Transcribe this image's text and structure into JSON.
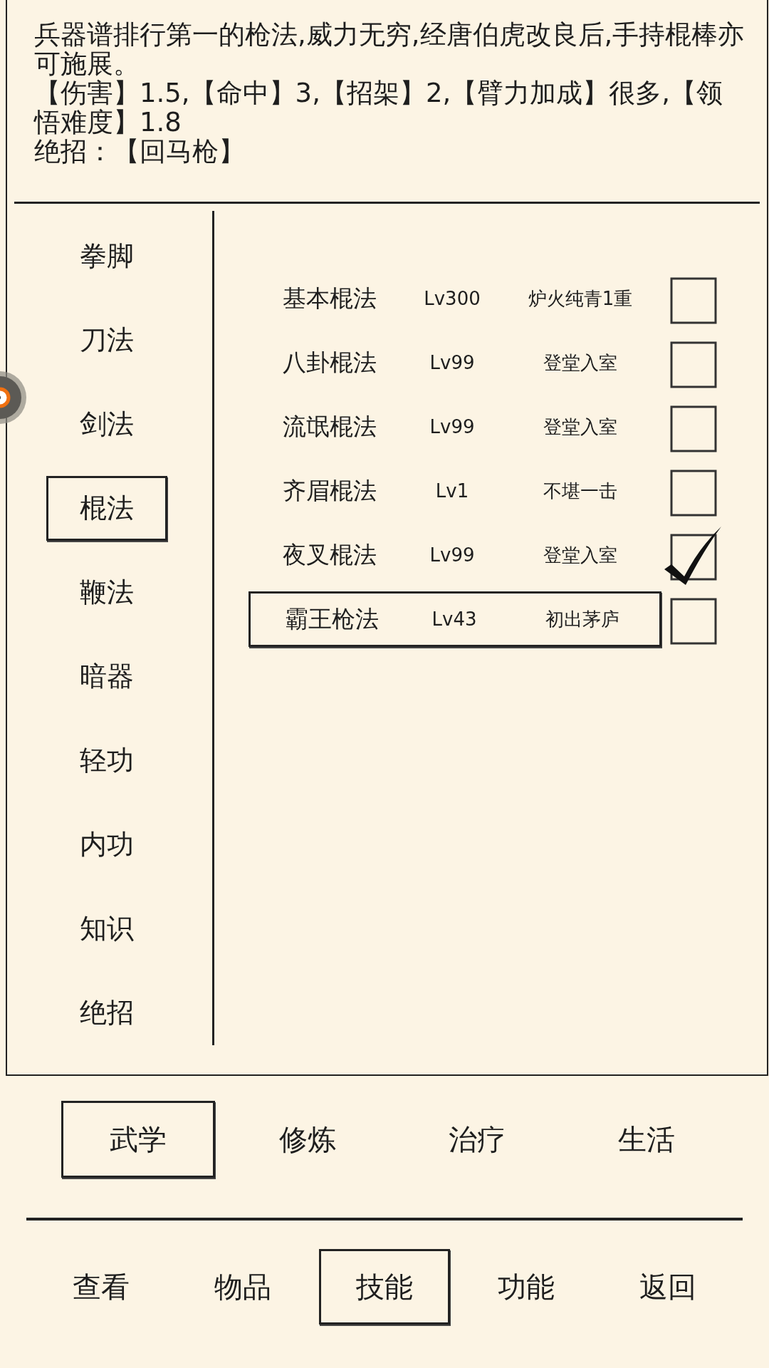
{
  "description": {
    "paragraphs": [
      "兵器谱排行第一的枪法,威力无穷,经唐伯虎改良后,手持棍棒亦可施展。",
      "【伤害】1.5,【命中】3,【招架】2,【臂力加成】很多,【领悟难度】1.8",
      "绝招：【回马枪】"
    ]
  },
  "categories": [
    {
      "label": "拳脚",
      "selected": false
    },
    {
      "label": "刀法",
      "selected": false
    },
    {
      "label": "剑法",
      "selected": false
    },
    {
      "label": "棍法",
      "selected": true
    },
    {
      "label": "鞭法",
      "selected": false
    },
    {
      "label": "暗器",
      "selected": false
    },
    {
      "label": "轻功",
      "selected": false
    },
    {
      "label": "内功",
      "selected": false
    },
    {
      "label": "知识",
      "selected": false
    },
    {
      "label": "绝招",
      "selected": false
    }
  ],
  "skills": [
    {
      "name": "基本棍法",
      "level": "Lv300",
      "rank": "炉火纯青1重",
      "checked": false,
      "selected": false
    },
    {
      "name": "八卦棍法",
      "level": "Lv99",
      "rank": "登堂入室",
      "checked": false,
      "selected": false
    },
    {
      "name": "流氓棍法",
      "level": "Lv99",
      "rank": "登堂入室",
      "checked": false,
      "selected": false
    },
    {
      "name": "齐眉棍法",
      "level": "Lv1",
      "rank": "不堪一击",
      "checked": false,
      "selected": false
    },
    {
      "name": "夜叉棍法",
      "level": "Lv99",
      "rank": "登堂入室",
      "checked": true,
      "selected": false
    },
    {
      "name": "霸王枪法",
      "level": "Lv43",
      "rank": "初出茅庐",
      "checked": false,
      "selected": true
    }
  ],
  "tabs": [
    {
      "label": "武学",
      "selected": true
    },
    {
      "label": "修炼",
      "selected": false
    },
    {
      "label": "治疗",
      "selected": false
    },
    {
      "label": "生活",
      "selected": false
    }
  ],
  "nav": [
    {
      "label": "查看",
      "selected": false
    },
    {
      "label": "物品",
      "selected": false
    },
    {
      "label": "技能",
      "selected": true
    },
    {
      "label": "功能",
      "selected": false
    },
    {
      "label": "返回",
      "selected": false
    }
  ]
}
